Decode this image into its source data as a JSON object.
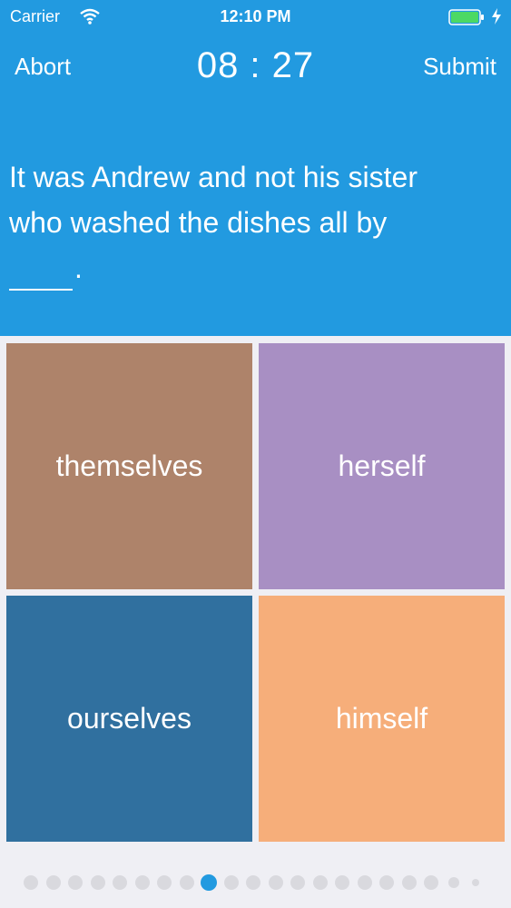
{
  "status_bar": {
    "carrier": "Carrier",
    "time": "12:10 PM"
  },
  "nav": {
    "abort_label": "Abort",
    "timer": "08 : 27",
    "submit_label": "Submit"
  },
  "question": {
    "line1": "It was Andrew and not his sister",
    "line2": "who washed the dishes all by",
    "line3_end": "."
  },
  "options": [
    {
      "label": "themselves",
      "color": "#ae836a"
    },
    {
      "label": "herself",
      "color": "#a88fc3"
    },
    {
      "label": "ourselves",
      "color": "#30709f"
    },
    {
      "label": "himself",
      "color": "#f6ae7a"
    }
  ],
  "pagination": {
    "total_dots": 21,
    "active_index": 8
  },
  "colors": {
    "header": "#229ae0",
    "background": "#efeff4"
  }
}
